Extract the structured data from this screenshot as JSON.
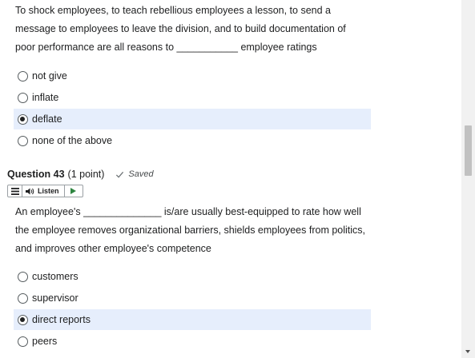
{
  "question42": {
    "text": "To shock employees, to teach rebellious employees a lesson, to send a message to employees to leave the division, and to build documentation of poor performance are all reasons to ___________ employee ratings",
    "options": [
      {
        "label": "not give",
        "selected": false
      },
      {
        "label": "inflate",
        "selected": false
      },
      {
        "label": "deflate",
        "selected": true
      },
      {
        "label": "none of the above",
        "selected": false
      }
    ]
  },
  "question43": {
    "title": "Question 43",
    "points": "(1 point)",
    "status": "Saved",
    "listen_label": "Listen",
    "text": "An employee's ______________ is/are usually best-equipped to rate how well the employee removes organizational barriers, shields employees from politics, and improves other employee's competence",
    "options": [
      {
        "label": "customers",
        "selected": false
      },
      {
        "label": "supervisor",
        "selected": false
      },
      {
        "label": "direct reports",
        "selected": true
      },
      {
        "label": "peers",
        "selected": false
      }
    ]
  },
  "icons": {
    "menu": "hamburger-menu-icon",
    "speaker": "speaker-icon",
    "play": "play-icon",
    "saved": "checkmark-icon"
  },
  "colors": {
    "selected_bg": "#e6eefc",
    "text": "#202122",
    "play_green": "#2e8540"
  }
}
